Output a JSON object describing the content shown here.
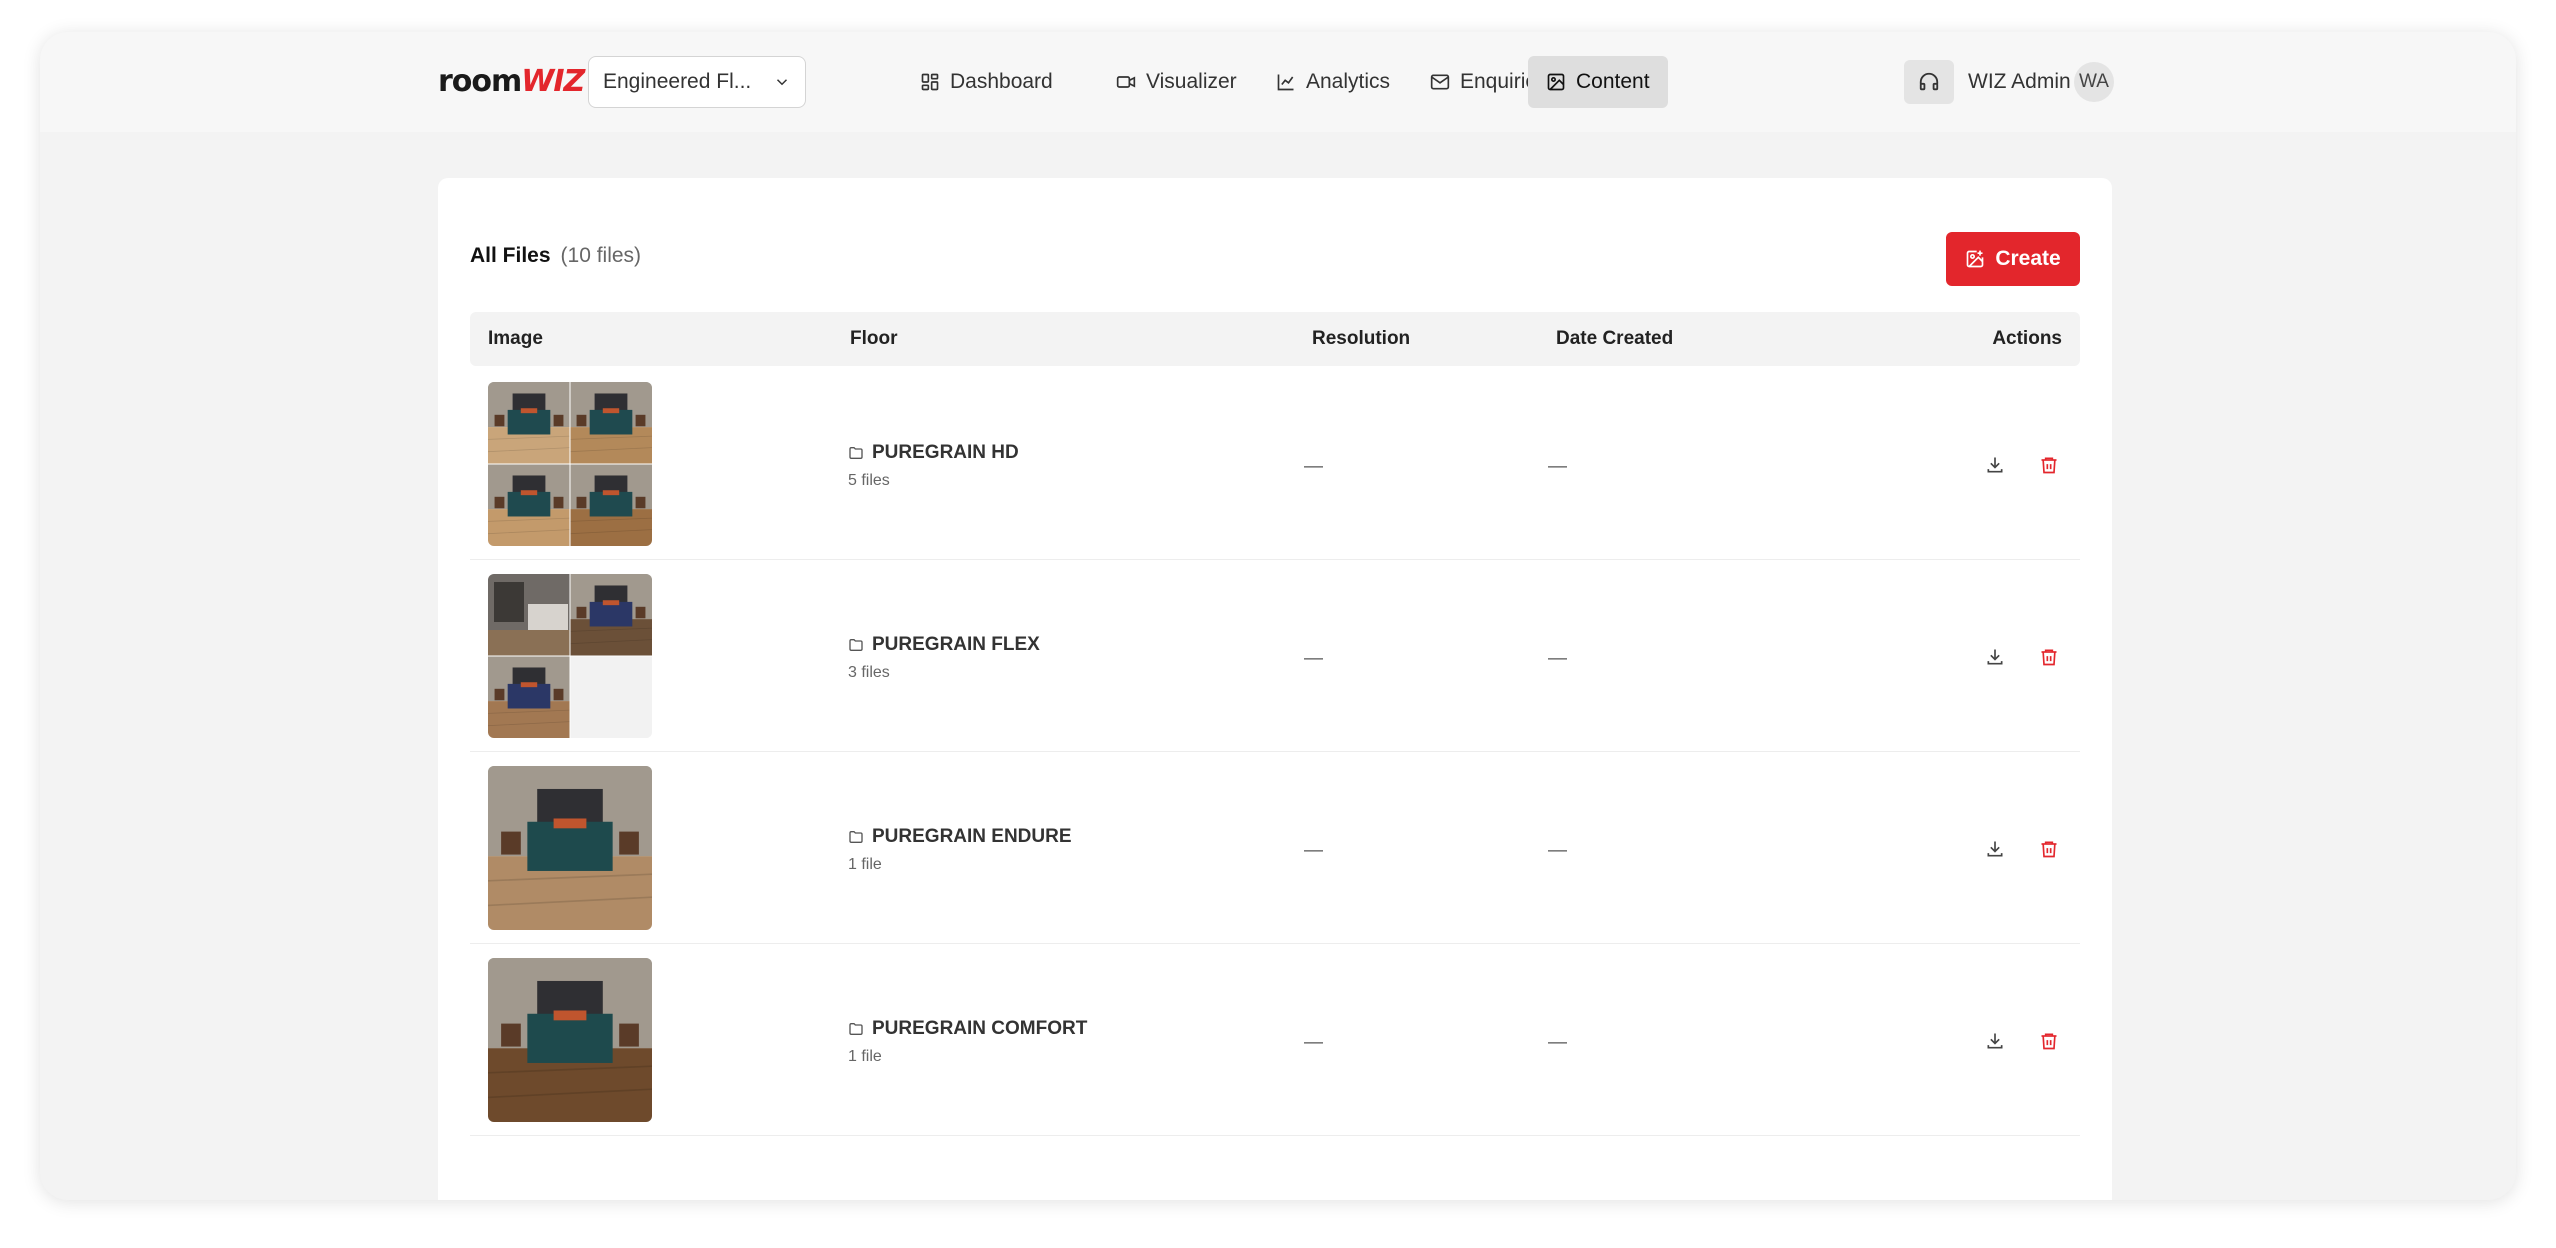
{
  "app": {
    "logo_room": "room",
    "logo_wiz": "WIZ"
  },
  "company_select": {
    "value": "Engineered Fl..."
  },
  "nav": [
    {
      "label": "Dashboard",
      "icon": "dashboard-icon"
    },
    {
      "label": "Visualizer",
      "icon": "video-icon"
    },
    {
      "label": "Analytics",
      "icon": "chart-icon"
    },
    {
      "label": "Enquiries",
      "icon": "mail-icon"
    },
    {
      "label": "Content",
      "icon": "image-icon",
      "active": true
    }
  ],
  "user": {
    "name": "WIZ Admin",
    "initials": "WA"
  },
  "files": {
    "title": "All Files",
    "count": "(10 files)",
    "create_label": "Create",
    "columns": [
      "Image",
      "Floor",
      "Resolution",
      "Date Created",
      "Actions"
    ],
    "rows": [
      {
        "name": "PUREGRAIN HD",
        "count": "5 files",
        "resolution": "—",
        "date": "—",
        "thumb_count": 4
      },
      {
        "name": "PUREGRAIN FLEX",
        "count": "3 files",
        "resolution": "—",
        "date": "—",
        "thumb_count": 3
      },
      {
        "name": "PUREGRAIN ENDURE",
        "count": "1 file",
        "resolution": "—",
        "date": "—",
        "thumb_count": 1
      },
      {
        "name": "PUREGRAIN COMFORT",
        "count": "1 file",
        "resolution": "—",
        "date": "—",
        "thumb_count": 1
      }
    ]
  },
  "colors": {
    "accent": "#e3262c",
    "active_nav": "#dedede",
    "page_bg": "#f3f3f3"
  }
}
